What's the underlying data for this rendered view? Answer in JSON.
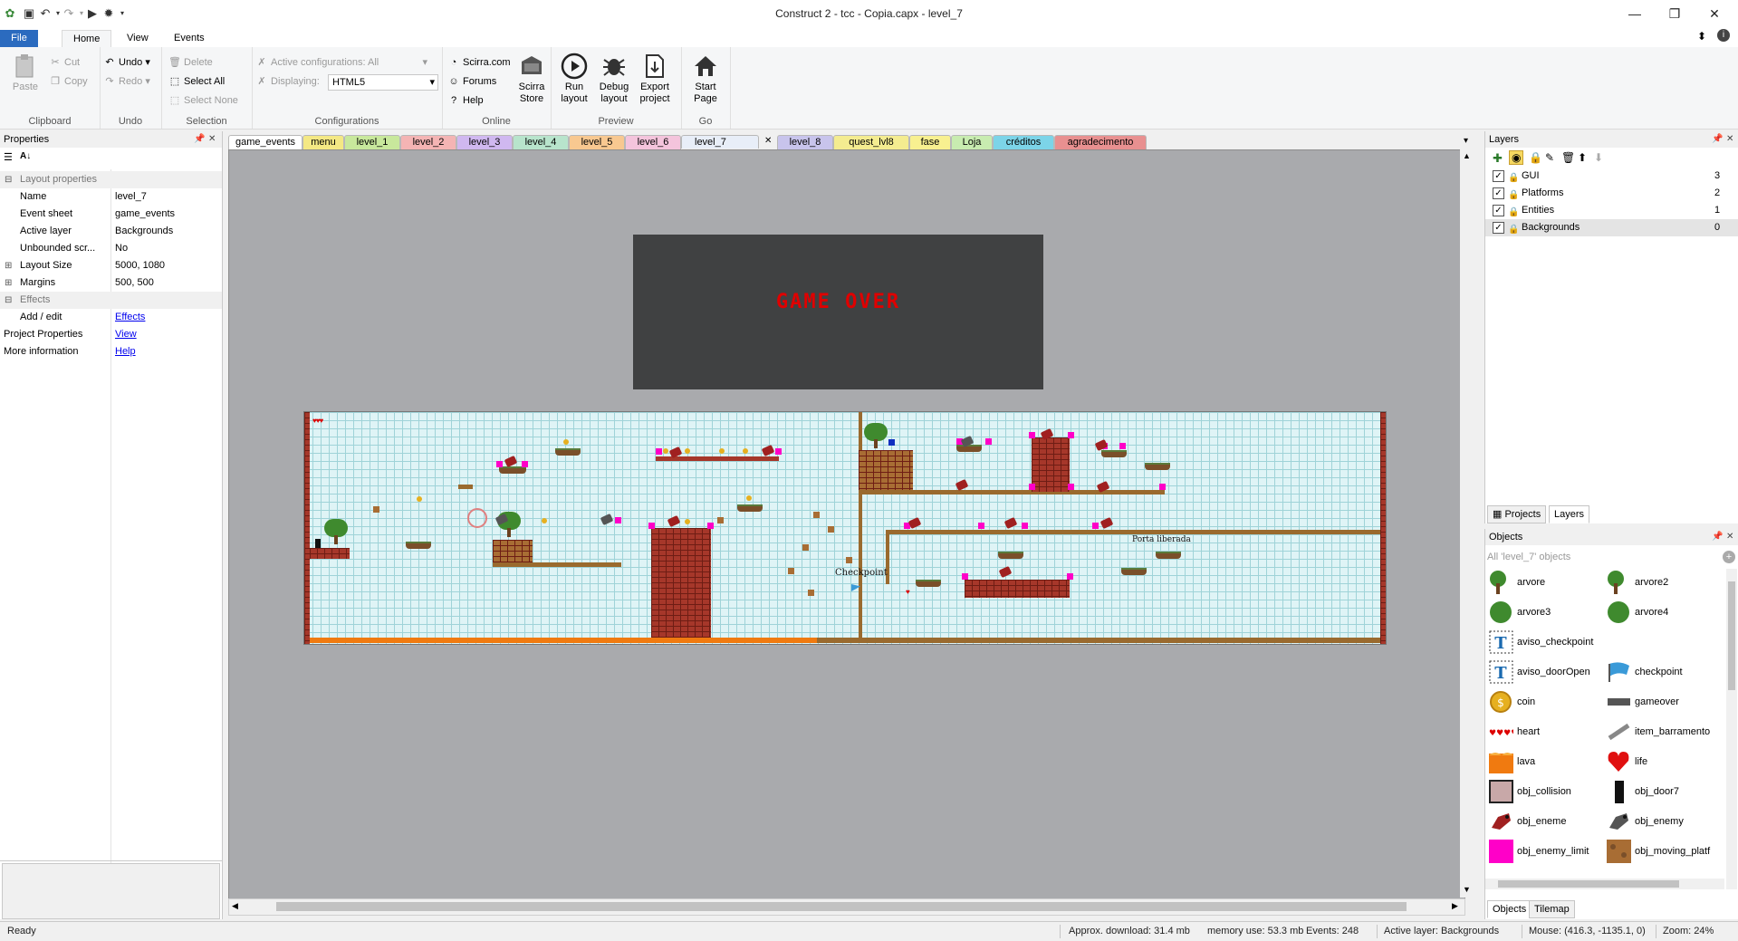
{
  "window": {
    "title": "Construct 2 - tcc - Copia.capx - level_7"
  },
  "ribbon_tabs": [
    "File",
    "Home",
    "View",
    "Events"
  ],
  "ribbon": {
    "clipboard": {
      "paste": "Paste",
      "cut": "Cut",
      "copy": "Copy",
      "label": "Clipboard"
    },
    "undo": {
      "undo": "Undo",
      "redo": "Redo",
      "label": "Undo"
    },
    "selection": {
      "delete": "Delete",
      "select_all": "Select All",
      "select_none": "Select None",
      "label": "Selection"
    },
    "configurations": {
      "active": "Active configurations: All",
      "displaying_label": "Displaying:",
      "displaying_value": "HTML5",
      "label": "Configurations"
    },
    "online": {
      "scirra": "Scirra.com",
      "forums": "Forums",
      "help": "Help",
      "store_line1": "Scirra",
      "store_line2": "Store",
      "label": "Online"
    },
    "preview": {
      "run_1": "Run",
      "run_2": "layout",
      "debug_1": "Debug",
      "debug_2": "layout",
      "export_1": "Export",
      "export_2": "project",
      "label": "Preview"
    },
    "go": {
      "start_1": "Start",
      "start_2": "Page",
      "label": "Go"
    }
  },
  "properties": {
    "title": "Properties",
    "category_layout": "Layout properties",
    "rows": [
      {
        "key": "Name",
        "value": "level_7"
      },
      {
        "key": "Event sheet",
        "value": "game_events"
      },
      {
        "key": "Active layer",
        "value": "Backgrounds"
      },
      {
        "key": "Unbounded scr...",
        "value": "No"
      },
      {
        "key": "Layout Size",
        "value": "5000, 1080"
      },
      {
        "key": "Margins",
        "value": "500, 500"
      }
    ],
    "category_effects": "Effects",
    "add_edit_key": "Add / edit",
    "add_edit_link": "Effects",
    "project_props_key": "Project Properties",
    "project_props_link": "View",
    "more_info_key": "More information",
    "more_info_link": "Help"
  },
  "layout_tabs": [
    {
      "label": "game_events",
      "color": "#ffffff"
    },
    {
      "label": "menu",
      "color": "#f4e884"
    },
    {
      "label": "level_1",
      "color": "#c8e89c"
    },
    {
      "label": "level_2",
      "color": "#f4b4b4"
    },
    {
      "label": "level_3",
      "color": "#d0b8f0"
    },
    {
      "label": "level_4",
      "color": "#b8e4cc"
    },
    {
      "label": "level_5",
      "color": "#f8c890"
    },
    {
      "label": "level_6",
      "color": "#f4c4dc"
    },
    {
      "label": "level_7",
      "color": "#e8eef8"
    },
    {
      "label": "level_8",
      "color": "#c8c4ec"
    },
    {
      "label": "quest_lvl8",
      "color": "#f4ec90"
    },
    {
      "label": "fase",
      "color": "#f8f090"
    },
    {
      "label": "Loja",
      "color": "#c8ecb0"
    },
    {
      "label": "créditos",
      "color": "#7cd4e8"
    },
    {
      "label": "agradecimento",
      "color": "#e89090"
    }
  ],
  "game": {
    "gameover_text": "GAME OVER",
    "checkpoint_text": "Checkpoint",
    "door_text": "Porta liberada"
  },
  "layers": {
    "title": "Layers",
    "items": [
      {
        "name": "GUI",
        "index": "3"
      },
      {
        "name": "Platforms",
        "index": "2"
      },
      {
        "name": "Entities",
        "index": "1"
      },
      {
        "name": "Backgrounds",
        "index": "0"
      }
    ],
    "tab_projects": "Projects",
    "tab_layers": "Layers"
  },
  "objects": {
    "title": "Objects",
    "filter": "All 'level_7' objects",
    "items": [
      {
        "name": "arvore",
        "icon": "tree-icon"
      },
      {
        "name": "arvore2",
        "icon": "tree-icon"
      },
      {
        "name": "arvore3",
        "icon": "bush-icon"
      },
      {
        "name": "arvore4",
        "icon": "bush-icon"
      },
      {
        "name": "aviso_checkpoint",
        "icon": "text-icon"
      },
      {
        "name": "aviso_doorOpen",
        "icon": "text-icon"
      },
      {
        "name": "checkpoint",
        "icon": "flag-icon"
      },
      {
        "name": "coin",
        "icon": "coin-icon"
      },
      {
        "name": "gameover",
        "icon": "panel-icon"
      },
      {
        "name": "heart",
        "icon": "hearts-icon"
      },
      {
        "name": "item_barramento",
        "icon": "bar-icon"
      },
      {
        "name": "lava",
        "icon": "lava-icon"
      },
      {
        "name": "life",
        "icon": "heart-icon"
      },
      {
        "name": "obj_collision",
        "icon": "box-icon"
      },
      {
        "name": "obj_door7",
        "icon": "door-icon"
      },
      {
        "name": "obj_eneme",
        "icon": "enemy-icon"
      },
      {
        "name": "obj_enemy",
        "icon": "enemy-icon"
      },
      {
        "name": "obj_enemy_limit",
        "icon": "limit-icon"
      },
      {
        "name": "obj_moving_platf",
        "icon": "platform-icon"
      }
    ],
    "tab_objects": "Objects",
    "tab_tilemap": "Tilemap"
  },
  "status": {
    "ready": "Ready",
    "download": "Approx. download: 31.4 mb",
    "memory": "memory use: 53.3 mb",
    "events": "Events: 248",
    "active_layer": "Active layer: Backgrounds",
    "mouse": "Mouse: (416.3, -1135.1, 0)",
    "zoom": "Zoom: 24%"
  }
}
